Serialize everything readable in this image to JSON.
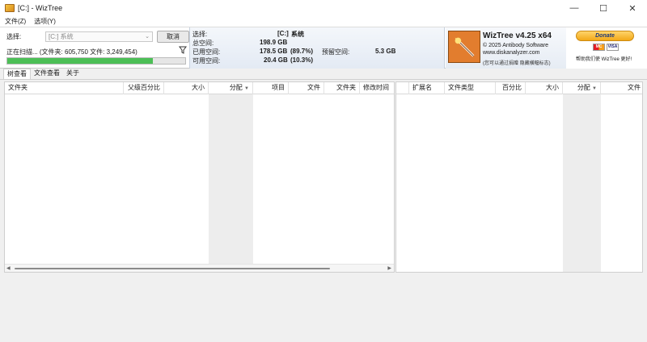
{
  "window": {
    "title": "[C:] - WizTree",
    "minimize": "—",
    "maximize": "☐",
    "close": "✕"
  },
  "menu": [
    "文件(Z)",
    "选项(Y)"
  ],
  "scan": {
    "select_label": "选择:",
    "drive_value": "[C:] 系统",
    "cancel_label": "取消",
    "status": "正在扫描... (文件夹: 605,750  文件: 3,249,454)",
    "progress_percent": 82
  },
  "stats": {
    "select_label": "选择:",
    "drive": "[C:]",
    "drive_name": "系统",
    "total_label": "总空间:",
    "total_value": "198.9 GB",
    "used_label": "已用空间:",
    "used_value": "178.5 GB",
    "used_pct": "(89.7%)",
    "free_label": "可用空间:",
    "free_value": "20.4 GB",
    "free_pct": "(10.3%)",
    "reserved_label": "预留空间:",
    "reserved_value": "5.3 GB"
  },
  "info": {
    "title": "WizTree v4.25 x64",
    "copyright": "© 2025 Antibody Software",
    "url": "www.diskanalyzer.com",
    "note": "(您可以通过捐赠 隐藏横幅标志)"
  },
  "donate": {
    "button": "Donate",
    "mastercard": "MC",
    "visa": "VISA",
    "note": "帮助我们使 WizTree 更好!"
  },
  "tabs": [
    "树查看",
    "文件查看",
    "关于"
  ],
  "tree_columns": [
    "文件夹",
    "父级百分比",
    "大小",
    "分配",
    "项目",
    "文件",
    "文件夹",
    "修改时间"
  ],
  "type_columns": [
    "扩展名",
    "文件类型",
    "百分比",
    "大小",
    "分配",
    "文件"
  ],
  "colors": {
    "progress": "#4cbf56",
    "allocated_column_shade": "#ededed"
  }
}
